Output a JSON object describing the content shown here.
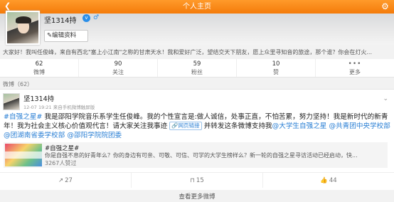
{
  "header": {
    "title": "个人主页",
    "back_icon": "back-arrow-icon",
    "settings_icon": "gear-icon"
  },
  "profile": {
    "username": "坚1314持",
    "verified_badge": "v",
    "gender_symbol": "♂",
    "edit_button": "编辑资料",
    "bio": "大家好！我叫任俊峰，来自有西北\"塞上小江南\"之称的甘肃天水！我和爱好广泛，望结交天下朋友，愿上众里寻知音的旅途，那个谁？你会在灯火..."
  },
  "stats": [
    {
      "num": "62",
      "label": "微博"
    },
    {
      "num": "90",
      "label": "关注"
    },
    {
      "num": "59",
      "label": "粉丝"
    },
    {
      "num": "10",
      "label": "赞"
    },
    {
      "icon": "•••",
      "label": "更多"
    }
  ],
  "section": {
    "label": "微博（62）"
  },
  "post": {
    "username": "坚1314持",
    "time": "12-07 19:21   来自手机微博触屏版",
    "text_topic": "#自强之星#",
    "text_body": " 我是邵阳学院音乐系学生任俊峰。我的个性宣言是:做人诚信，处事正直，不怕苦累，努力坚持！我是新时代的新青年！我为社会主义核心价值观代言！请大家关注我事迹 ",
    "text_link_pill": "网页链接",
    "text_body2": " 并转发这条微博支持我",
    "mention1": "@大学生自强之星",
    "mention2": "@共青团中央学校部",
    "mention3": "@团湖南省委学校部",
    "mention4": "@邵阳学院院团委",
    "quote": {
      "title": "#自强之星#",
      "desc": "你是自强不息的好青年么？你的身边有可亲、可敬、可信、可学的大学生榜样么？新一轮的自强之星寻访活动已经启动，快...",
      "stat": "3267人赞过"
    },
    "actions": [
      {
        "icon": "↗",
        "count": "27"
      },
      {
        "icon": "⊓",
        "count": "15"
      },
      {
        "icon": "👍",
        "count": "44"
      }
    ]
  },
  "footer": {
    "more_posts": "查看更多微博"
  }
}
